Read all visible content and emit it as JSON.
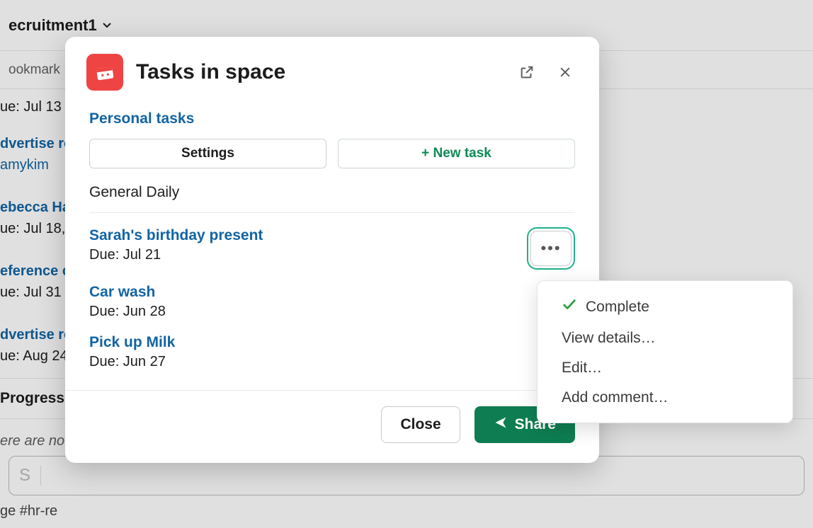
{
  "background": {
    "channel_name": "ecruitment1",
    "bookmark_label": "ookmark",
    "items": [
      {
        "title_fragment": "",
        "due": "ue: Jul 13"
      },
      {
        "title_fragment": "dvertise ro",
        "assignee": "amykim",
        "due": ""
      },
      {
        "title_fragment": "ebecca Ha",
        "due": "ue: Jul 18,"
      },
      {
        "title_fragment": "eference c",
        "due": "ue: Jul 31"
      },
      {
        "title_fragment": "dvertise ro",
        "due": "ue: Aug 24"
      }
    ],
    "section_header": "Progress",
    "empty_text": "ere are no",
    "compose_hint": "ge #hr-re"
  },
  "modal": {
    "title": "Tasks in space",
    "personal_tasks_link": "Personal tasks",
    "settings_label": "Settings",
    "new_task_label": "+ New task",
    "section_title": "General Daily",
    "tasks": [
      {
        "title": "Sarah's birthday present",
        "due": "Due: Jul 21"
      },
      {
        "title": "Car wash",
        "due": "Due: Jun 28"
      },
      {
        "title": "Pick up Milk",
        "due": "Due: Jun 27"
      }
    ],
    "close_label": "Close",
    "share_label": "Share"
  },
  "menu": {
    "complete": "Complete",
    "view_details": "View details…",
    "edit": "Edit…",
    "add_comment": "Add comment…"
  }
}
